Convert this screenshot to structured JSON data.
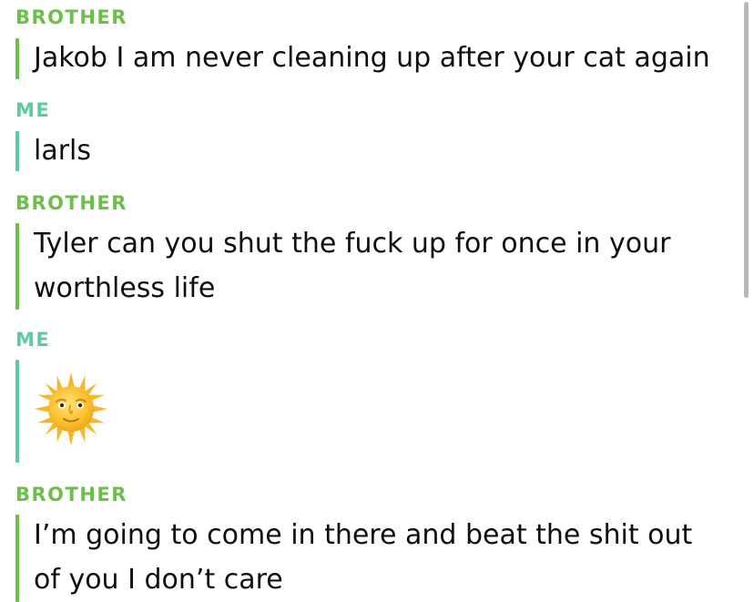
{
  "colors": {
    "brother": "#6cc04a",
    "me": "#5ccca0",
    "text": "#0f0f0f",
    "scrollbar": "#b9b9b9"
  },
  "messages": [
    {
      "sender": "BROTHER",
      "type": "text",
      "lines": [
        "Jakob I am never cleaning up after your cat again"
      ]
    },
    {
      "sender": "ME",
      "type": "text",
      "lines": [
        "larls"
      ]
    },
    {
      "sender": "BROTHER",
      "type": "text",
      "lines": [
        "Tyler can you shut the fuck up for once in your",
        "worthless life"
      ]
    },
    {
      "sender": "ME",
      "type": "emoji",
      "emoji": "sun-with-face-emoji"
    },
    {
      "sender": "BROTHER",
      "type": "text",
      "lines": [
        "I’m going to come in there and beat the shit out",
        "of you I don’t care"
      ]
    }
  ]
}
